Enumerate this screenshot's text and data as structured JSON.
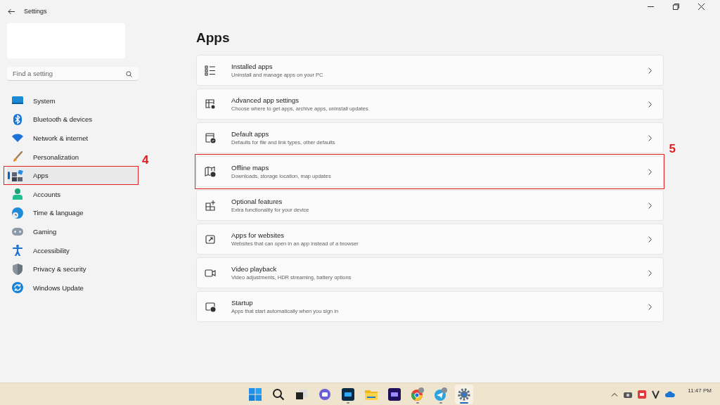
{
  "window": {
    "title": "Settings"
  },
  "search": {
    "placeholder": "Find a setting"
  },
  "sidebar": {
    "items": [
      {
        "label": "System",
        "selected": false
      },
      {
        "label": "Bluetooth & devices",
        "selected": false
      },
      {
        "label": "Network & internet",
        "selected": false
      },
      {
        "label": "Personalization",
        "selected": false
      },
      {
        "label": "Apps",
        "selected": true,
        "annotation": "4"
      },
      {
        "label": "Accounts",
        "selected": false
      },
      {
        "label": "Time & language",
        "selected": false
      },
      {
        "label": "Gaming",
        "selected": false
      },
      {
        "label": "Accessibility",
        "selected": false
      },
      {
        "label": "Privacy & security",
        "selected": false
      },
      {
        "label": "Windows Update",
        "selected": false
      }
    ]
  },
  "page": {
    "title": "Apps"
  },
  "cards": [
    {
      "title": "Installed apps",
      "subtitle": "Uninstall and manage apps on your PC"
    },
    {
      "title": "Advanced app settings",
      "subtitle": "Choose where to get apps, archive apps, uninstall updates"
    },
    {
      "title": "Default apps",
      "subtitle": "Defaults for file and link types, other defaults"
    },
    {
      "title": "Offline maps",
      "subtitle": "Downloads, storage location, map updates",
      "annotation": "5"
    },
    {
      "title": "Optional features",
      "subtitle": "Extra functionality for your device"
    },
    {
      "title": "Apps for websites",
      "subtitle": "Websites that can open in an app instead of a browser"
    },
    {
      "title": "Video playback",
      "subtitle": "Video adjustments, HDR streaming, battery options"
    },
    {
      "title": "Startup",
      "subtitle": "Apps that start automatically when you sign in"
    }
  ],
  "taskbar": {
    "icons": [
      {
        "running": false,
        "active": false
      },
      {
        "running": false,
        "active": false
      },
      {
        "running": false,
        "active": false
      },
      {
        "running": false,
        "active": false
      },
      {
        "running": true,
        "active": false
      },
      {
        "running": false,
        "active": false
      },
      {
        "running": false,
        "active": false
      },
      {
        "running": true,
        "active": false
      },
      {
        "running": true,
        "active": false
      },
      {
        "running": true,
        "active": true
      }
    ]
  },
  "tray": {
    "time": "11:47 PM"
  }
}
